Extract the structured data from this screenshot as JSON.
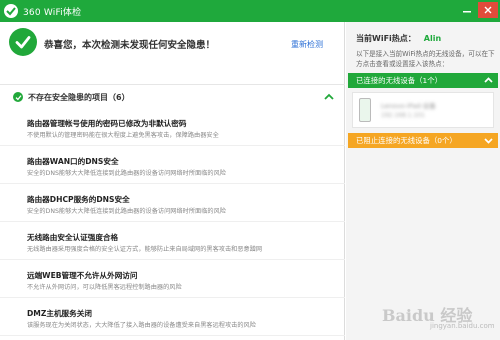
{
  "window": {
    "title": "360 WiFi体检",
    "controls": [
      "minimize",
      "close"
    ],
    "accent_green": "#1fa93c",
    "accent_orange": "#f5a623"
  },
  "header": {
    "message": "恭喜您，本次检测未发现任何安全隐患！",
    "recheck_label": "重新检测"
  },
  "section": {
    "label": "不存在安全隐患的项目（6）"
  },
  "items": [
    {
      "title": "路由器管理帐号使用的密码已修改为非默认密码",
      "desc": "不使用默认的管理密码能在很大程度上避免黑客攻击，保障路由器安全"
    },
    {
      "title": "路由器WAN口的DNS安全",
      "desc": "安全的DNS能够大大降低连接到此路由器的设备访问网络时所面临的风险"
    },
    {
      "title": "路由器DHCP服务的DNS安全",
      "desc": "安全的DNS能够大大降低连接到此路由器的设备访问网络时所面临的风险"
    },
    {
      "title": "无线路由安全认证强度合格",
      "desc": "无线路由器采用强度合格的安全认证方式，能够防止来自局域网的黑客攻击和恶意蹭网"
    },
    {
      "title": "远端WEB管理不允许从外网访问",
      "desc": "不允许从外网访问，可以降低黑客远程控制路由器的风险"
    },
    {
      "title": "DMZ主机服务关闭",
      "desc": "该服务现在为关闭状态，大大降低了接入路由器的设备遭受来自黑客远程攻击的风险"
    }
  ],
  "sidebar": {
    "hotspot_label": "当前WiFi热点：",
    "hotspot_name": "Alin",
    "hint": "以下是接入当前WiFi热点的无线设备，可以在下方点击查看或设置接入该热点：",
    "connected_label": "已连接的无线设备（1个）",
    "blocked_label": "已阻止连接的无线设备（0个）",
    "device": {
      "name": "Lenovo-iPad-设备",
      "sub": "192.168.1.101"
    }
  },
  "watermark": {
    "text": "Baidu 经验",
    "url": "jingyan.baidu.com"
  }
}
